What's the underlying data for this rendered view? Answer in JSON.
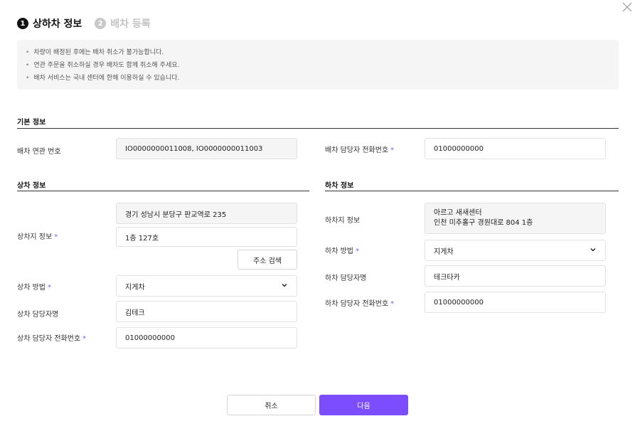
{
  "steps": [
    {
      "num": "1",
      "label": "상하차 정보"
    },
    {
      "num": "2",
      "label": "배차 등록"
    }
  ],
  "notices": [
    "차량이 배정된 후에는 배차 취소가 불가능합니다.",
    "연관 주문을 취소하실 경우 배차도 함께 취소해 주세요.",
    "배차 서비스는 국내 센터에 한해 이용하실 수 있습니다."
  ],
  "basic": {
    "title": "기본 정보",
    "dispatch_no_label": "배차 연관 번호",
    "dispatch_no_value": "IO0000000011008, IO0000000011003",
    "manager_phone_label": "배차 담당자 전화번호",
    "manager_phone_value": "01000000000"
  },
  "loading": {
    "title": "상차 정보",
    "location_label": "상차지 정보",
    "address": "경기 성남시 분당구 판교역로 235",
    "address_detail": "1층 127호",
    "search_button": "주소 검색",
    "method_label": "상차 방법",
    "method_value": "지게차",
    "contact_label": "상차 담당자명",
    "contact_value": "김테크",
    "phone_label": "상차 담당자 전화번호",
    "phone_value": "01000000000"
  },
  "unloading": {
    "title": "하차 정보",
    "location_label": "하차지 정보",
    "location_name": "아르고 새새센터",
    "location_address": "인천 미추홀구 경원대로 804 1층",
    "method_label": "하차 방법",
    "method_value": "지게차",
    "contact_label": "하차 담당자명",
    "contact_value": "테크타카",
    "phone_label": "하차 담당자 전화번호",
    "phone_value": "01000000000"
  },
  "footer": {
    "cancel": "취소",
    "next": "다음"
  },
  "colors": {
    "accent": "#7b4dff",
    "required": "#7b5cff"
  },
  "icons": {
    "close": "close-icon",
    "dropdown": "chevron-down-icon"
  }
}
